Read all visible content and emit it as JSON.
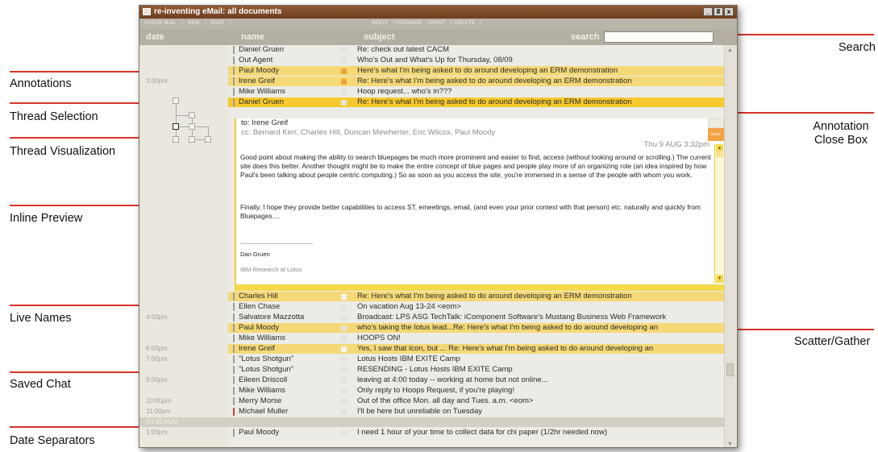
{
  "window": {
    "title": "re-inventing eMail: all documents",
    "controls": [
      "_",
      "8",
      "x"
    ]
  },
  "toolbar": {
    "left_buttons": [
      "CHECK MAIL",
      "NEW",
      "CHAT"
    ],
    "right_buttons": [
      "REPLY",
      "FORWARD",
      "PRINT",
      "DELETE"
    ]
  },
  "columns": {
    "date": "date",
    "name": "name",
    "subject": "subject"
  },
  "search": {
    "label": "search",
    "value": ""
  },
  "messages": [
    {
      "time": "",
      "name": "Daniel Gruen",
      "subject": "Re: check out latest CACM",
      "style": "normal",
      "chip": "none"
    },
    {
      "time": "",
      "name": "Out Agent",
      "subject": "Who's Out and What's Up for Thursday, 08/09",
      "style": "normal",
      "chip": "none"
    },
    {
      "time": "",
      "name": "Paul Moody",
      "subject": "Here's what I'm being asked to do around developing an ERM demonstration",
      "style": "hl",
      "chip": "orange"
    },
    {
      "time": "3:00pm",
      "name": "Irene Greif",
      "subject": "Re: Here's what I'm being asked to do around developing an ERM demonstration",
      "style": "hl",
      "chip": "orange"
    },
    {
      "time": "",
      "name": "Mike Williams",
      "subject": "Hoop request... who's in???",
      "style": "normal",
      "chip": "none"
    },
    {
      "time": "",
      "name": "Daniel Gruen",
      "subject": "Re: Here's what I'm being asked to do around developing an ERM demonstration",
      "style": "sel",
      "chip": "none"
    }
  ],
  "preview": {
    "to": "to: Irene Greif",
    "cc_prefix": "cc:",
    "cc": [
      "Bernard Kerr,",
      "Charles Hill,",
      "Duncan Mewherter,",
      "Eric Wilcox,",
      "Paul Moody"
    ],
    "date": "Thu 9 AUG 3:32pm",
    "para1": "Good point about making the ability to search bluepages be much more prominent and easier to find, access (without looking around or scrolling.) The current site does this better. Another thought might be to make the entire concept of blue pages and people play more of an organizing role (an idea inspired by how Paul's been talking about people centric computing.) So as soon as you access the site, you're immersed in a sense of the people with whom you work.",
    "para2": "Finally, I hope they provide better capabilities to access ST, emeetings, email, (and even your prior context with that person) etc. naturally and quickly from Bluepages....",
    "signature_name": "Dan Gruen",
    "signature_org": "IBM Research at Lotus",
    "close_label": "close"
  },
  "messages_after": [
    {
      "time": "",
      "name": "Charles Hill",
      "subject": "Re: Here's what I'm being asked to do around developing an ERM demonstration",
      "style": "hl",
      "chip": "white"
    },
    {
      "time": "",
      "name": "Ellen Chase",
      "subject": "On vacation Aug 13-24 <eom>",
      "style": "normal",
      "chip": "none"
    },
    {
      "time": "4:00pm",
      "name": "Salvatore Mazzotta",
      "subject": "Broadcast: LPS ASG TechTalk: iComponent Software's Mustang Business Web Framework",
      "style": "normal",
      "chip": "none"
    },
    {
      "time": "",
      "name": "Paul Moody",
      "subject": "who's taking the lotus lead...Re: Here's what I'm being asked to do around developing an",
      "style": "hl",
      "chip": "none"
    },
    {
      "time": "",
      "name": "Mike Williams",
      "subject": "HOOPS ON!",
      "style": "normal",
      "chip": "none"
    },
    {
      "time": "6:00pm",
      "name": "Irene Greif",
      "subject": "Yes, I saw that icon, but ... Re: Here's what I'm being asked to do around developing an",
      "style": "hl",
      "chip": "white"
    },
    {
      "time": "7:00pm",
      "name": "\"Lotus Shotgun\"",
      "subject": "Lotus Hosts IBM EXITE Camp",
      "style": "normal",
      "chip": "none"
    },
    {
      "time": "",
      "name": "\"Lotus Shotgun\"",
      "subject": "RESENDING - Lotus Hosts IBM EXITE Camp",
      "style": "normal",
      "chip": "none"
    },
    {
      "time": "9:00pm",
      "name": "Eileen Driscoll",
      "subject": "leaving at 4:00 today -- working at home but not online...",
      "style": "normal",
      "chip": "none"
    },
    {
      "time": "",
      "name": "Mike Williams",
      "subject": "Only reply to Hoops Request, if you're playing!",
      "style": "normal",
      "chip": "none"
    },
    {
      "time": "10:00pm",
      "name": "Merry Morse",
      "subject": "Out of the office Mon. all day and Tues. a.m. <eom>",
      "style": "normal",
      "chip": "none"
    },
    {
      "time": "11:00pm",
      "name": "Michael Muller",
      "subject": "I'll be here but unreliable on Tuesday",
      "style": "normal",
      "chip": "none"
    },
    {
      "time": "Fri 10 AUG",
      "name": "",
      "subject": "",
      "style": "sep",
      "chip": "none"
    },
    {
      "time": "1:00pm",
      "name": "Paul Moody",
      "subject": "I need 1 hour of your time to collect data for chi paper (1/2hr needed now)",
      "style": "normal",
      "chip": "none"
    }
  ],
  "callouts_left": [
    "Annotations",
    "Thread Selection",
    "Thread Visualization",
    "Inline Preview",
    "Live Names",
    "Saved Chat",
    "Date Separators"
  ],
  "callouts_right": [
    "Search",
    "Annotation Close Box",
    "Scatter/Gather"
  ],
  "colors": {
    "highlight": "#f4d976",
    "selected": "#f6c92e",
    "callout_line": "#d9332b",
    "titlebar": "#7a4626"
  }
}
